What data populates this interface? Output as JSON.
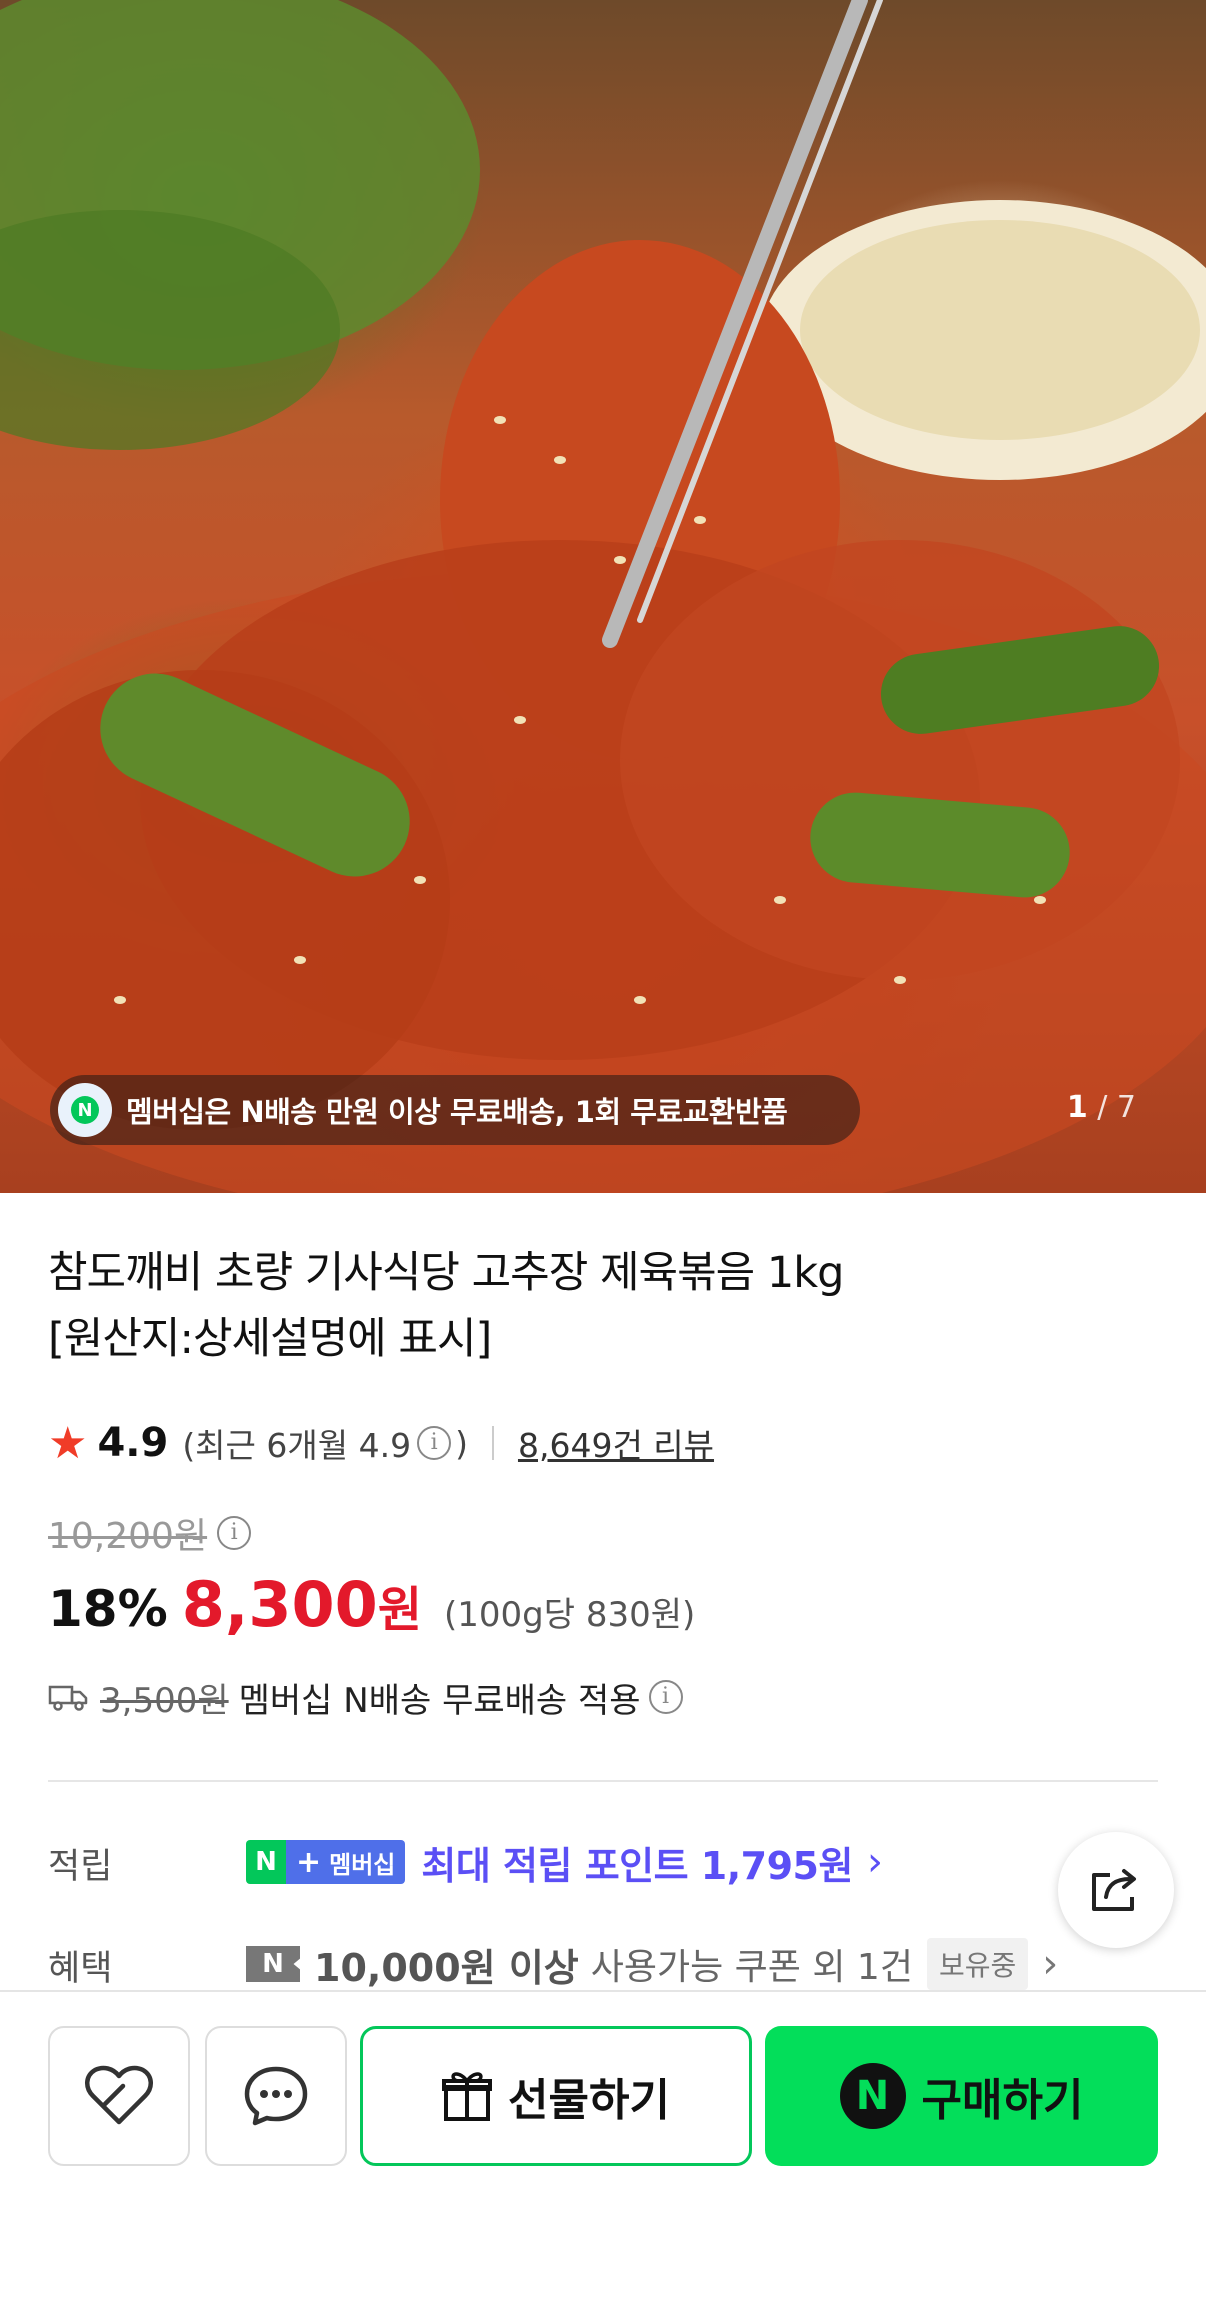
{
  "gallery": {
    "banner_badge": "N",
    "banner_text": "멤버십은 N배송 만원 이상 무료배송, 1회 무료교환반품",
    "current": "1",
    "separator": "/",
    "total": "7"
  },
  "product": {
    "title_line1": "참도깨비 초량 기사식당 고추장 제육볶음 1kg",
    "title_line2": "[원산지:상세설명에 표시]",
    "rating": "4.9",
    "recent_rating": "(최근 6개월 4.9",
    "recent_rating_close": ")",
    "reviews": "8,649건 리뷰",
    "original_price": "10,200원",
    "discount": "18%",
    "price": "8,300",
    "price_unit": "원",
    "unit_price": "(100g당 830원)",
    "shipping_old": "3,500원",
    "shipping_text": "멤버십 N배송 무료배송 적용"
  },
  "benefits": {
    "points_label": "적립",
    "membership_badge_n": "N",
    "membership_badge_plus": "+",
    "membership_badge_text": "멤버십",
    "points_text": "최대 적립 포인트 1,795원",
    "benefit_label": "혜택",
    "coupon_icon": "N",
    "coupon_strong": "10,000원 이상",
    "coupon_text": "사용가능 쿠폰 외 1건",
    "hold_badge": "보유중"
  },
  "actions": {
    "gift_label": "선물하기",
    "buy_badge": "N",
    "buy_label": "구매하기"
  },
  "colors": {
    "naver_green": "#03de5a",
    "price_red": "#e3192b",
    "points_purple": "#5b4ff5",
    "membership_blue": "#4f6fe9"
  },
  "icons": [
    "star-icon",
    "info-icon",
    "delivery-truck-icon",
    "share-icon",
    "heart-icon",
    "chat-icon",
    "gift-icon",
    "chevron-right-icon",
    "coupon-icon"
  ]
}
